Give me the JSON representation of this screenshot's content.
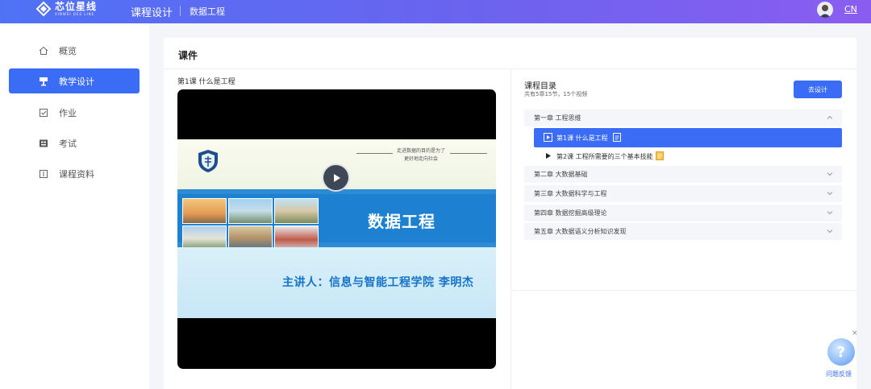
{
  "header": {
    "logo_cn": "芯位星线",
    "logo_en": "XINWEI DEE LINE",
    "title": "课程设计",
    "subtitle": "数据工程",
    "lang": "CN"
  },
  "sidebar": {
    "items": [
      {
        "label": "概览",
        "icon": "home-icon"
      },
      {
        "label": "教学设计",
        "icon": "design-icon",
        "active": true
      },
      {
        "label": "作业",
        "icon": "homework-icon"
      },
      {
        "label": "考试",
        "icon": "exam-icon"
      },
      {
        "label": "课程资料",
        "icon": "materials-icon"
      }
    ]
  },
  "main": {
    "card_title": "课件",
    "current_lesson": "第1课 什么是工程",
    "video": {
      "motto_line1": "走进数据的目的是为了",
      "motto_line2": "更好地走向社会",
      "slide_title": "数据工程",
      "presenter": "主讲人：信息与智能工程学院  李明杰"
    }
  },
  "catalog": {
    "title": "课程目录",
    "summary": "共有5章15节，15个视频",
    "button_label": "去设计",
    "chapters": [
      {
        "title": "第一章 工程思维",
        "expanded": true,
        "lessons": [
          {
            "title": "第1课 什么是工程",
            "active": true
          },
          {
            "title": "第2课 工程所需要的三个基本技能",
            "active": false
          }
        ]
      },
      {
        "title": "第二章 大数据基础",
        "expanded": false
      },
      {
        "title": "第三章 大数据科学与工程",
        "expanded": false
      },
      {
        "title": "第四章 数据挖掘高级理论",
        "expanded": false
      },
      {
        "title": "第五章 大数据语义分析知识发现",
        "expanded": false
      }
    ]
  },
  "feedback": {
    "label": "问题反馈",
    "close": "×",
    "icon_glyph": "?"
  },
  "colors": {
    "primary": "#3a6cf5",
    "header_start": "#4f72f5",
    "header_end": "#8a5df0"
  }
}
